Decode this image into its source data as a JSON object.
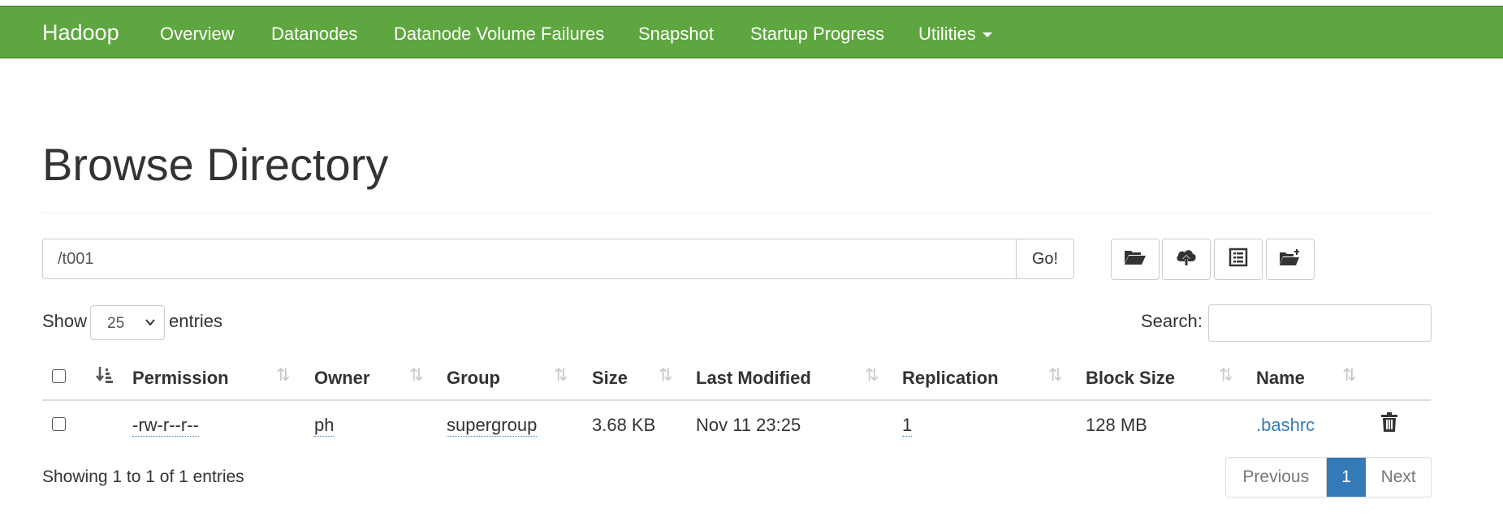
{
  "nav": {
    "brand": "Hadoop",
    "items": [
      "Overview",
      "Datanodes",
      "Datanode Volume Failures",
      "Snapshot",
      "Startup Progress"
    ],
    "utilities": "Utilities"
  },
  "title": "Browse Directory",
  "path_input": {
    "value": "/t001"
  },
  "go_label": "Go!",
  "toolbar": {
    "icons": [
      "folder-open-icon",
      "cloud-upload-icon",
      "list-alt-icon",
      "new-folder-icon"
    ]
  },
  "length": {
    "show": "Show",
    "value": "25",
    "entries": "entries"
  },
  "search_label": "Search:",
  "table": {
    "columns": [
      "Permission",
      "Owner",
      "Group",
      "Size",
      "Last Modified",
      "Replication",
      "Block Size",
      "Name"
    ],
    "rows": [
      {
        "permission": "-rw-r--r--",
        "owner": "ph",
        "group": "supergroup",
        "size": "3.68 KB",
        "last_modified": "Nov 11 23:25",
        "replication": "1",
        "block_size": "128 MB",
        "name": ".bashrc"
      }
    ]
  },
  "info": "Showing 1 to 1 of 1 entries",
  "pagination": {
    "previous": "Previous",
    "current": "1",
    "next": "Next"
  },
  "colors": {
    "navbar": "#5ea640",
    "link": "#337ab7",
    "active_page": "#337ab7"
  }
}
